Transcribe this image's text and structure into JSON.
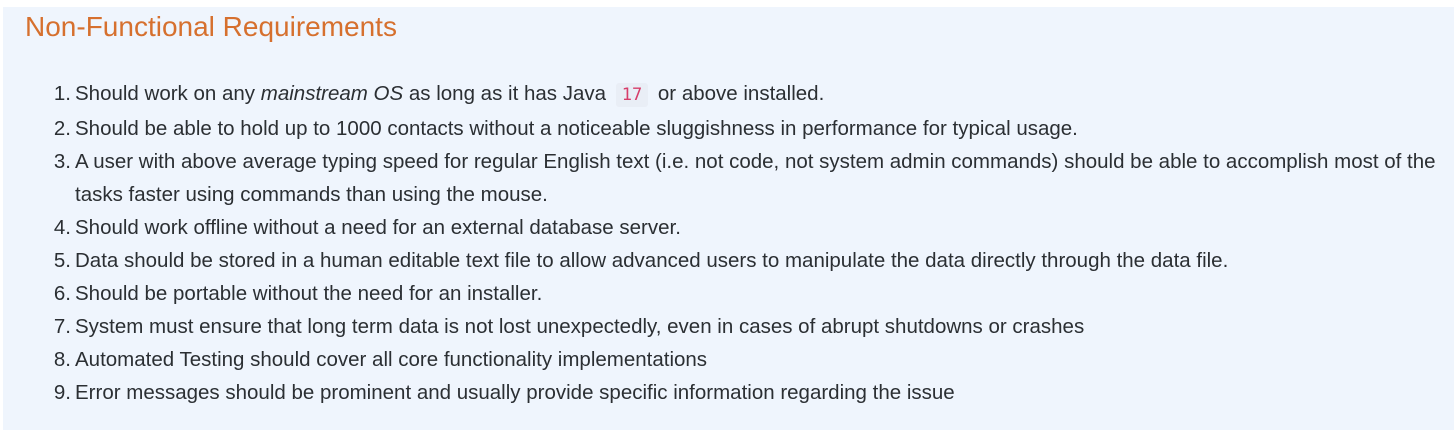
{
  "heading": "Non-Functional Requirements",
  "requirements": [
    {
      "number": "1.",
      "part1": "Should work on any ",
      "emphasis": "mainstream OS",
      "part2": " as long as it has Java ",
      "code": "17",
      "part3": " or above installed."
    },
    {
      "number": "2.",
      "text": "Should be able to hold up to 1000 contacts without a noticeable sluggishness in performance for typical usage."
    },
    {
      "number": "3.",
      "text": "A user with above average typing speed for regular English text (i.e. not code, not system admin commands) should be able to accomplish most of the tasks faster using commands than using the mouse."
    },
    {
      "number": "4.",
      "text": "Should work offline without a need for an external database server."
    },
    {
      "number": "5.",
      "text": "Data should be stored in a human editable text file to allow advanced users to manipulate the data directly through the data file."
    },
    {
      "number": "6.",
      "text": "Should be portable without the need for an installer."
    },
    {
      "number": "7.",
      "text": "System must ensure that long term data is not lost unexpectedly, even in cases of abrupt shutdowns or crashes"
    },
    {
      "number": "8.",
      "text": "Automated Testing should cover all core functionality implementations"
    },
    {
      "number": "9.",
      "text": "Error messages should be prominent and usually provide specific information regarding the issue"
    }
  ]
}
